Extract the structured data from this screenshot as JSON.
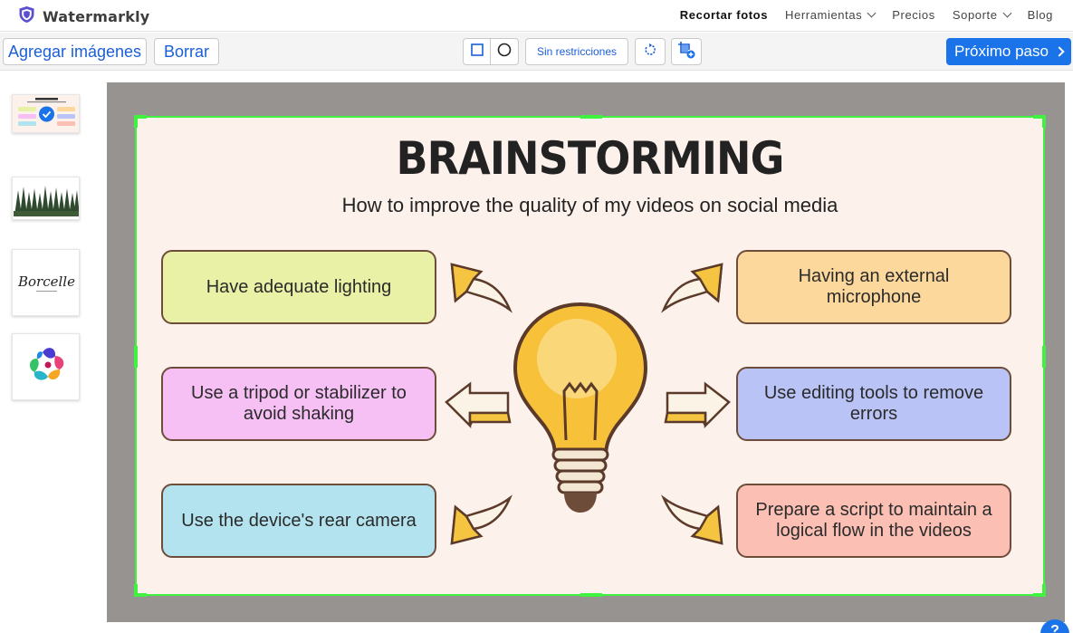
{
  "app": {
    "name": "Watermarkly"
  },
  "nav": {
    "items": [
      {
        "label": "Recortar fotos",
        "active": true,
        "has_dropdown": false
      },
      {
        "label": "Herramientas",
        "active": false,
        "has_dropdown": true
      },
      {
        "label": "Precios",
        "active": false,
        "has_dropdown": false
      },
      {
        "label": "Soporte",
        "active": false,
        "has_dropdown": true
      },
      {
        "label": "Blog",
        "active": false,
        "has_dropdown": false
      }
    ]
  },
  "toolbar": {
    "add_images": "Agregar imágenes",
    "delete": "Borrar",
    "shape_rect_icon": "square-icon",
    "shape_circle_icon": "circle-icon",
    "aspect_ratio": "Sin restricciones",
    "rotate_icon": "rotate-icon",
    "add_crop_icon": "add-crop-icon",
    "next_step": "Próximo paso"
  },
  "sidebar": {
    "thumbnails": [
      {
        "name": "brainstorming-infographic",
        "selected": true
      },
      {
        "name": "forest-photo",
        "selected": false
      },
      {
        "name": "borcelle-logo",
        "selected": false,
        "logo_text": "Borcelle"
      },
      {
        "name": "colorful-abstract-logo",
        "selected": false
      }
    ]
  },
  "image": {
    "title": "BRAINSTORMING",
    "subtitle": "How to improve the quality of my videos on social media",
    "cards": [
      {
        "text": "Have adequate lighting",
        "color": "#e9f1a6"
      },
      {
        "text": "Having an external microphone",
        "color": "#fcd89c"
      },
      {
        "text": "Use a tripod or stabilizer to avoid shaking",
        "color": "#f6c0f5"
      },
      {
        "text": "Use editing tools to remove errors",
        "color": "#b9c3f6"
      },
      {
        "text": "Use the device's rear camera",
        "color": "#b3e3ee"
      },
      {
        "text": "Prepare a script to maintain a logical flow in the videos",
        "color": "#fbbfb4"
      }
    ]
  },
  "colors": {
    "accent": "#1a73e8",
    "crop_border": "#3ff23f",
    "canvas_bg": "#969391",
    "card_border": "#6e4c3a"
  },
  "help": {
    "label": "?"
  }
}
